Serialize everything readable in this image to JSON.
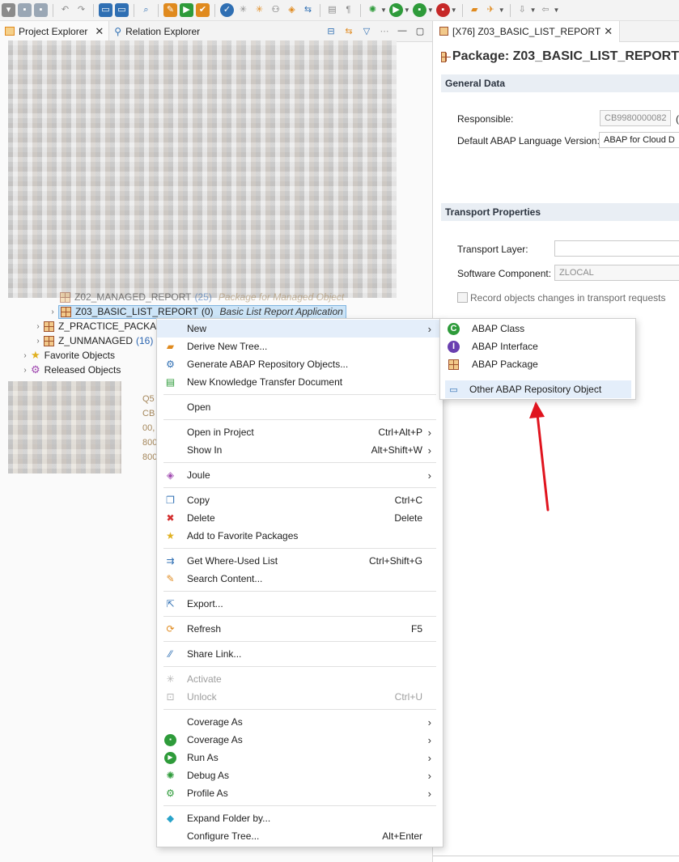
{
  "toolbar": {
    "icons": [
      "new-file-icon",
      "save-icon",
      "save-all-icon",
      "undo-icon",
      "redo-icon",
      "monitor-icon",
      "console-icon",
      "search-icon",
      "open-package-icon",
      "abap-run-icon",
      "transport-icon",
      "check-icon",
      "activate-icon",
      "activate-all-icon",
      "where-used-icon",
      "tag-icon",
      "compare-icon",
      "format-icon",
      "pilcrow-icon",
      "debug-icon",
      "run-icon",
      "coverage-icon",
      "profile-icon",
      "open-folder-icon",
      "pin-icon",
      "back-icon",
      "forward-icon"
    ],
    "colors": {
      "blue": "#2f6fb3",
      "green": "#2e9b3a",
      "orange": "#e08a1e",
      "gray": "#8b8b8b",
      "red": "#c62828"
    }
  },
  "left_panel": {
    "tabs": [
      {
        "label": "Project Explorer",
        "icon": "project-explorer-icon",
        "active": true
      },
      {
        "label": "Relation Explorer",
        "icon": "relation-explorer-icon",
        "active": false
      }
    ],
    "tree": {
      "partial_row": {
        "name": "Z02_MANAGED_REPORT",
        "count": "(25)",
        "description": "Package for Managed Object"
      },
      "selected_row": {
        "name": "Z03_BASIC_LIST_REPORT",
        "count": "(0)",
        "description": "Basic List Report Application"
      },
      "rows": [
        {
          "name": "Z_PRACTICE_PACKAG",
          "count": "",
          "icon": "package-icon"
        },
        {
          "name": "Z_UNMANAGED",
          "count": "(16)",
          "icon": "package-icon"
        },
        {
          "name": "Favorite Objects",
          "count": "",
          "icon": "star-icon"
        },
        {
          "name": "Released Objects",
          "count": "",
          "icon": "gear-icon"
        }
      ],
      "partial_text": [
        "Q5",
        "CB",
        "00,",
        "800",
        "800"
      ]
    }
  },
  "editor": {
    "tab_label": "[X76] Z03_BASIC_LIST_REPORT",
    "title": "Package: Z03_BASIC_LIST_REPORT",
    "general_data": {
      "header": "General Data",
      "responsible_label": "Responsible:",
      "responsible_value": "CB9980000082",
      "responsible_extra": "(",
      "language_label": "Default ABAP Language Version:",
      "language_value": "ABAP for Cloud D"
    },
    "transport": {
      "header": "Transport Properties",
      "layer_label": "Transport Layer:",
      "layer_value": "",
      "component_label": "Software Component:",
      "component_value": "ZLOCAL",
      "record_label": "Record objects changes in transport requests"
    }
  },
  "context_menu": {
    "items": [
      {
        "label": "New",
        "icon": "",
        "shortcut": "",
        "submenu": true,
        "highlight": true
      },
      {
        "label": "Derive New Tree...",
        "icon": "derive-tree-icon",
        "shortcut": "",
        "submenu": false
      },
      {
        "label": "Generate ABAP Repository Objects...",
        "icon": "generate-icon",
        "shortcut": "",
        "submenu": false
      },
      {
        "label": "New Knowledge Transfer Document",
        "icon": "knowledge-doc-icon",
        "shortcut": "",
        "submenu": false
      },
      {
        "label": "Open",
        "icon": "",
        "shortcut": "",
        "submenu": false
      },
      {
        "label": "Open in Project",
        "icon": "",
        "shortcut": "Ctrl+Alt+P",
        "submenu": true
      },
      {
        "label": "Show In",
        "icon": "",
        "shortcut": "Alt+Shift+W",
        "submenu": true
      },
      {
        "label": "Joule",
        "icon": "joule-icon",
        "shortcut": "",
        "submenu": true
      },
      {
        "label": "Copy",
        "icon": "copy-icon",
        "shortcut": "Ctrl+C",
        "submenu": false
      },
      {
        "label": "Delete",
        "icon": "delete-icon",
        "shortcut": "Delete",
        "submenu": false
      },
      {
        "label": "Add to Favorite Packages",
        "icon": "favorite-icon",
        "shortcut": "",
        "submenu": false
      },
      {
        "label": "Get Where-Used List",
        "icon": "where-used-icon",
        "shortcut": "Ctrl+Shift+G",
        "submenu": false
      },
      {
        "label": "Search Content...",
        "icon": "search-content-icon",
        "shortcut": "",
        "submenu": false
      },
      {
        "label": "Export...",
        "icon": "export-icon",
        "shortcut": "",
        "submenu": false
      },
      {
        "label": "Refresh",
        "icon": "refresh-icon",
        "shortcut": "F5",
        "submenu": false
      },
      {
        "label": "Share Link...",
        "icon": "share-link-icon",
        "shortcut": "",
        "submenu": false
      },
      {
        "label": "Activate",
        "icon": "activate-icon",
        "shortcut": "",
        "submenu": false,
        "disabled": true
      },
      {
        "label": "Unlock",
        "icon": "unlock-icon",
        "shortcut": "Ctrl+U",
        "submenu": false,
        "disabled": true
      },
      {
        "label": "Coverage As",
        "icon": "",
        "shortcut": "",
        "submenu": true
      },
      {
        "label": "Coverage As",
        "icon": "coverage-icon",
        "shortcut": "",
        "submenu": true
      },
      {
        "label": "Run As",
        "icon": "run-icon",
        "shortcut": "",
        "submenu": true
      },
      {
        "label": "Debug As",
        "icon": "debug-icon",
        "shortcut": "",
        "submenu": true
      },
      {
        "label": "Profile As",
        "icon": "profile-icon",
        "shortcut": "",
        "submenu": true
      },
      {
        "label": "Expand Folder by...",
        "icon": "expand-folder-icon",
        "shortcut": "",
        "submenu": false
      },
      {
        "label": "Configure Tree...",
        "icon": "",
        "shortcut": "Alt+Enter",
        "submenu": false
      }
    ]
  },
  "submenu": {
    "items": [
      {
        "label": "ABAP Class",
        "icon": "abap-class-icon"
      },
      {
        "label": "ABAP Interface",
        "icon": "abap-interface-icon"
      },
      {
        "label": "ABAP Package",
        "icon": "abap-package-icon"
      },
      {
        "label": "Other ABAP Repository Object",
        "icon": "other-object-icon",
        "highlight": true
      }
    ]
  },
  "annotation": {
    "color": "#e0141e",
    "icon": "red-arrow-icon"
  }
}
